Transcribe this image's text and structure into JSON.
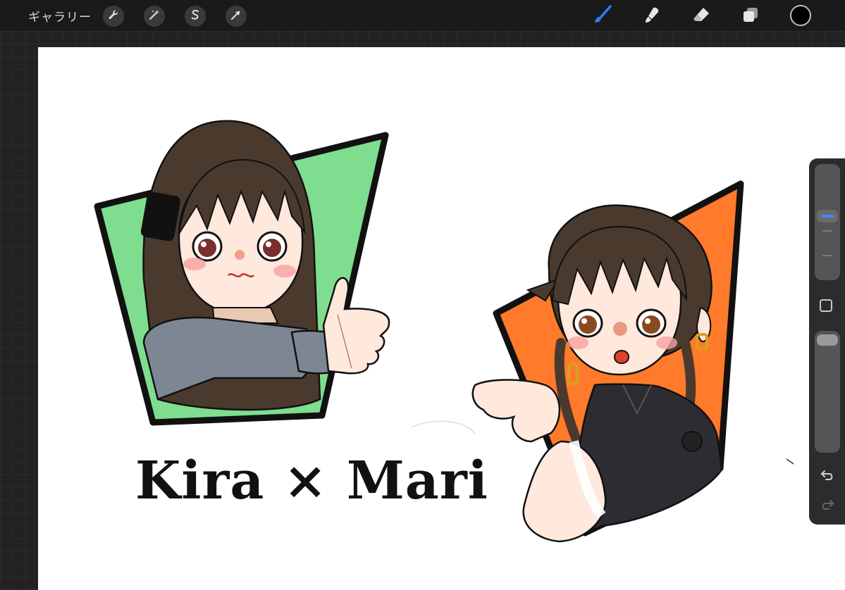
{
  "app": {
    "gallery_label": "ギャラリー"
  },
  "toolbar_left": [
    {
      "name": "wrench-icon"
    },
    {
      "name": "magic-wand-icon"
    },
    {
      "name": "selection-s-icon"
    },
    {
      "name": "arrow-transform-icon"
    }
  ],
  "toolbar_right": [
    {
      "name": "brush-icon",
      "active": true,
      "color": "#2f7bff"
    },
    {
      "name": "smudge-icon"
    },
    {
      "name": "eraser-icon"
    },
    {
      "name": "layers-icon"
    }
  ],
  "current_color": "#000000",
  "canvas": {
    "title_text": "Kira × Mari",
    "left_panel_color": "#7fdd8f",
    "right_panel_color": "#ff7a2a"
  },
  "sidebar": {
    "accent": "#3d8bff"
  }
}
